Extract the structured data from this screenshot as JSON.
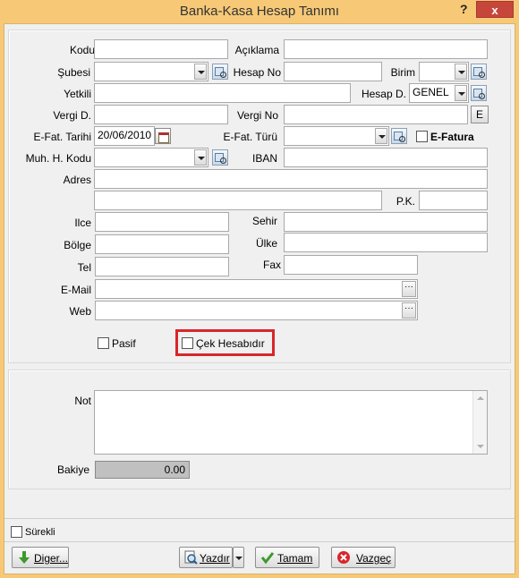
{
  "window": {
    "title": "Banka-Kasa Hesap Tanımı",
    "help": "?",
    "close": "x"
  },
  "labels": {
    "kodu": "Kodu",
    "aciklama": "Açıklama",
    "subesi": "Şubesi",
    "hesap_no": "Hesap No",
    "birim": "Birim",
    "yetkili": "Yetkili",
    "hesap_d": "Hesap D.",
    "vergi_d": "Vergi D.",
    "vergi_no": "Vergi No",
    "efat_tarihi": "E-Fat. Tarihi",
    "efat_turu": "E-Fat. Türü",
    "efatura": "E-Fatura",
    "muh_kodu": "Muh. H. Kodu",
    "iban": "IBAN",
    "adres": "Adres",
    "pk": "P.K.",
    "ilce": "Ilce",
    "sehir": "Sehir",
    "bolge": "Bölge",
    "ulke": "Ülke",
    "tel": "Tel",
    "fax": "Fax",
    "email": "E-Mail",
    "web": "Web",
    "pasif": "Pasif",
    "cek_hesabidir": "Çek Hesabıdır",
    "not": "Not",
    "bakiye": "Bakiye",
    "surekli": "Sürekli"
  },
  "values": {
    "kodu": "",
    "aciklama": "",
    "subesi": "",
    "hesap_no": "",
    "birim": "",
    "yetkili": "",
    "hesap_d": "GENEL",
    "vergi_d": "",
    "vergi_no": "",
    "efat_tarihi": "20/06/2010",
    "efat_turu": "",
    "muh_kodu": "",
    "iban": "",
    "adres1": "",
    "adres2": "",
    "pk": "",
    "ilce": "",
    "sehir": "",
    "bolge": "",
    "ulke": "",
    "tel": "",
    "fax": "",
    "email": "",
    "web": "",
    "not": "",
    "bakiye": "0.00"
  },
  "checkboxes": {
    "efatura": false,
    "pasif": false,
    "cek_hesabidir": false,
    "surekli": false
  },
  "buttons": {
    "e": "E",
    "diger": "Diger...",
    "yazdir": "Yazdır",
    "tamam": "Tamam",
    "vazgec": "Vazgeç"
  },
  "colors": {
    "title_bar": "#f7c977",
    "highlight": "#d8262b",
    "close_button": "#c7463b"
  },
  "icons": {
    "diger": "down-arrow-icon",
    "yazdir": "print-preview-icon",
    "tamam": "checkmark-icon",
    "vazgec": "cancel-icon"
  }
}
